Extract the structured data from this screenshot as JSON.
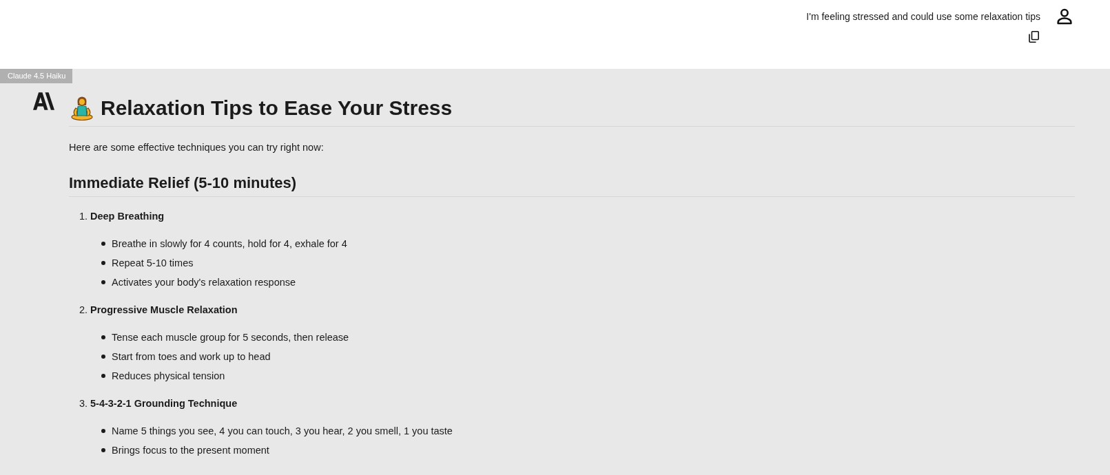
{
  "user_message": {
    "text": "I'm feeling stressed and could use some relaxation tips"
  },
  "model_badge": "Claude 4.5 Haiku",
  "response": {
    "title": "Relaxation Tips to Ease Your Stress",
    "intro": "Here are some effective techniques you can try right now:",
    "sections": [
      {
        "heading": "Immediate Relief (5-10 minutes)",
        "items": [
          {
            "number": "1.",
            "title": "Deep Breathing",
            "points": [
              "Breathe in slowly for 4 counts, hold for 4, exhale for 4",
              "Repeat 5-10 times",
              "Activates your body's relaxation response"
            ]
          },
          {
            "number": "2.",
            "title": "Progressive Muscle Relaxation",
            "points": [
              "Tense each muscle group for 5 seconds, then release",
              "Start from toes and work up to head",
              "Reduces physical tension"
            ]
          },
          {
            "number": "3.",
            "title": "5-4-3-2-1 Grounding Technique",
            "points": [
              "Name 5 things you see, 4 you can touch, 3 you hear, 2 you smell, 1 you taste",
              "Brings focus to the present moment"
            ]
          }
        ]
      }
    ]
  }
}
